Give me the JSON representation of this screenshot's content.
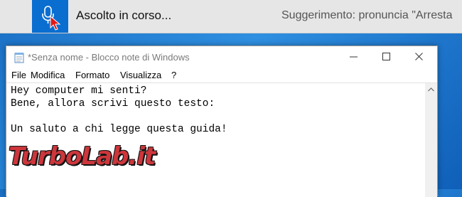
{
  "speech_bar": {
    "status": "Ascolto in corso...",
    "hint": "Suggerimento: pronuncia \"Arresta"
  },
  "window": {
    "title": "*Senza nome - Blocco note di Windows",
    "menu": [
      "File",
      "Modifica",
      "Formato",
      "Visualizza",
      "?"
    ],
    "lines": [
      "Hey computer mi senti?",
      "Bene, allora scrivi questo testo:",
      "",
      "Un saluto a chi legge questa guida!"
    ]
  },
  "watermark": {
    "text": "TurboLab.it"
  },
  "colors": {
    "accent": "#0a6ed1",
    "watermark": "#c9262b"
  },
  "icons": [
    "microphone-icon",
    "mouse-cursor-icon",
    "notepad-icon",
    "minimize-icon",
    "maximize-icon",
    "close-icon",
    "scroll-up-icon"
  ]
}
